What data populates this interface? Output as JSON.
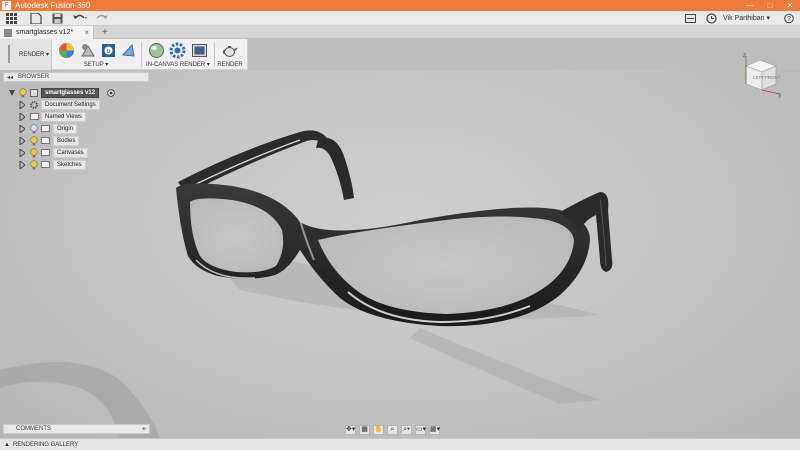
{
  "window": {
    "title": "Autodesk Fusion 360",
    "logo_letter": "F"
  },
  "window_controls": {
    "minimize": "—",
    "maximize": "□",
    "close": "✕"
  },
  "quick_access": {
    "user_name": "Vik Parthiban ▾"
  },
  "document_tab": {
    "name": "smartglasses v12*",
    "close": "×",
    "add": "+"
  },
  "toolbar": {
    "workspace": "RENDER ▾",
    "groups": [
      {
        "label": "SETUP ▾"
      },
      {
        "label": "IN-CANVAS RENDER ▾"
      },
      {
        "label": "RENDER"
      }
    ]
  },
  "browser": {
    "header": "BROWSER",
    "collapse": "◂◂",
    "root": "smartglasses v12",
    "items": [
      {
        "label": "Document Settings"
      },
      {
        "label": "Named Views"
      },
      {
        "label": "Origin"
      },
      {
        "label": "Bodies"
      },
      {
        "label": "Canvases"
      },
      {
        "label": "Sketches"
      }
    ]
  },
  "viewcube": {
    "left": "LEFT",
    "front": "FRONT",
    "axis_x": "X",
    "axis_z": "Z"
  },
  "comments": {
    "label": "COMMENTS",
    "add": "+"
  },
  "navbar": {
    "icons": [
      "✥▾",
      "▦",
      "✋",
      "⌕",
      "⌕▾",
      "▭▾",
      "▦▾"
    ]
  },
  "gallery": {
    "label": "RENDERING GALLERY",
    "toggle": "▲"
  },
  "colors": {
    "titlebar": "#ef7b3b",
    "viewport": "#c3c3c3",
    "frame": "#2b2b2b"
  }
}
